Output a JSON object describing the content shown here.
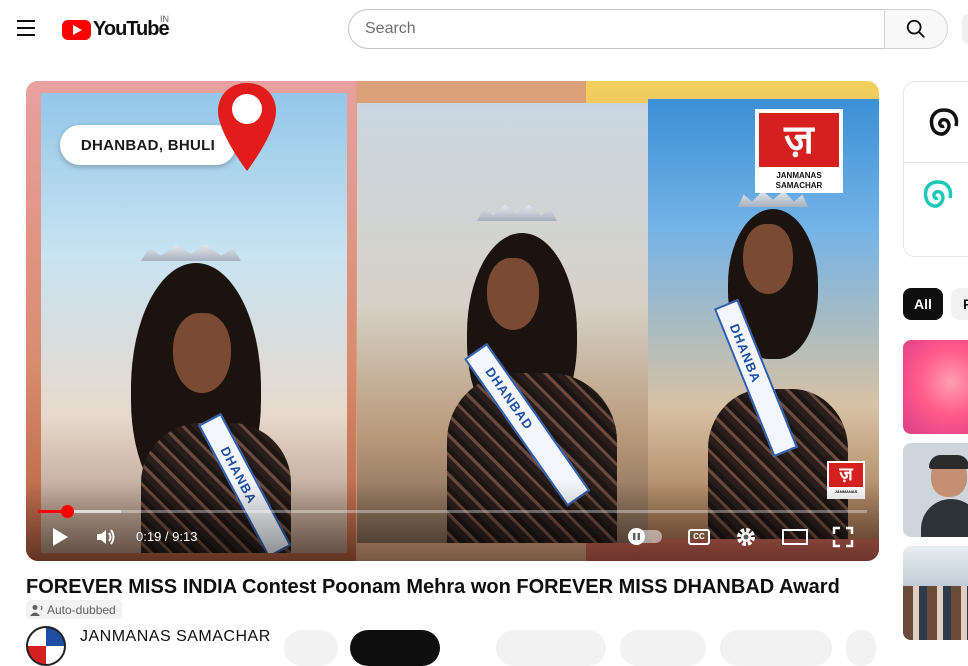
{
  "header": {
    "logo_text": "YouTube",
    "region": "IN",
    "search_placeholder": "Search"
  },
  "player": {
    "location_label": "DHANBAD, BHULI",
    "brand_logo_glyph": "ज़",
    "brand_line1": "JANMANAS",
    "brand_line2": "SAMACHAR",
    "sash_text_1": "DHANBA",
    "sash_text_2": "DHANBAD",
    "sash_text_3": "DHANBA",
    "time_display": "0:19 / 9:13",
    "progress_fraction": 0.035,
    "buffer_fraction": 0.1,
    "cc_label": "CC"
  },
  "video": {
    "title": "FOREVER MISS INDIA Contest Poonam Mehra won FOREVER MISS DHANBAD Award",
    "dub_badge": "Auto-dubbed",
    "channel_name": "JANMANAS SAMACHAR"
  },
  "sidebar": {
    "chips": [
      {
        "label": "All"
      },
      {
        "label": "F"
      }
    ]
  },
  "colors": {
    "brand_red": "#ff0000",
    "logo_red": "#d62020",
    "sash_blue": "#2f5fb0"
  }
}
